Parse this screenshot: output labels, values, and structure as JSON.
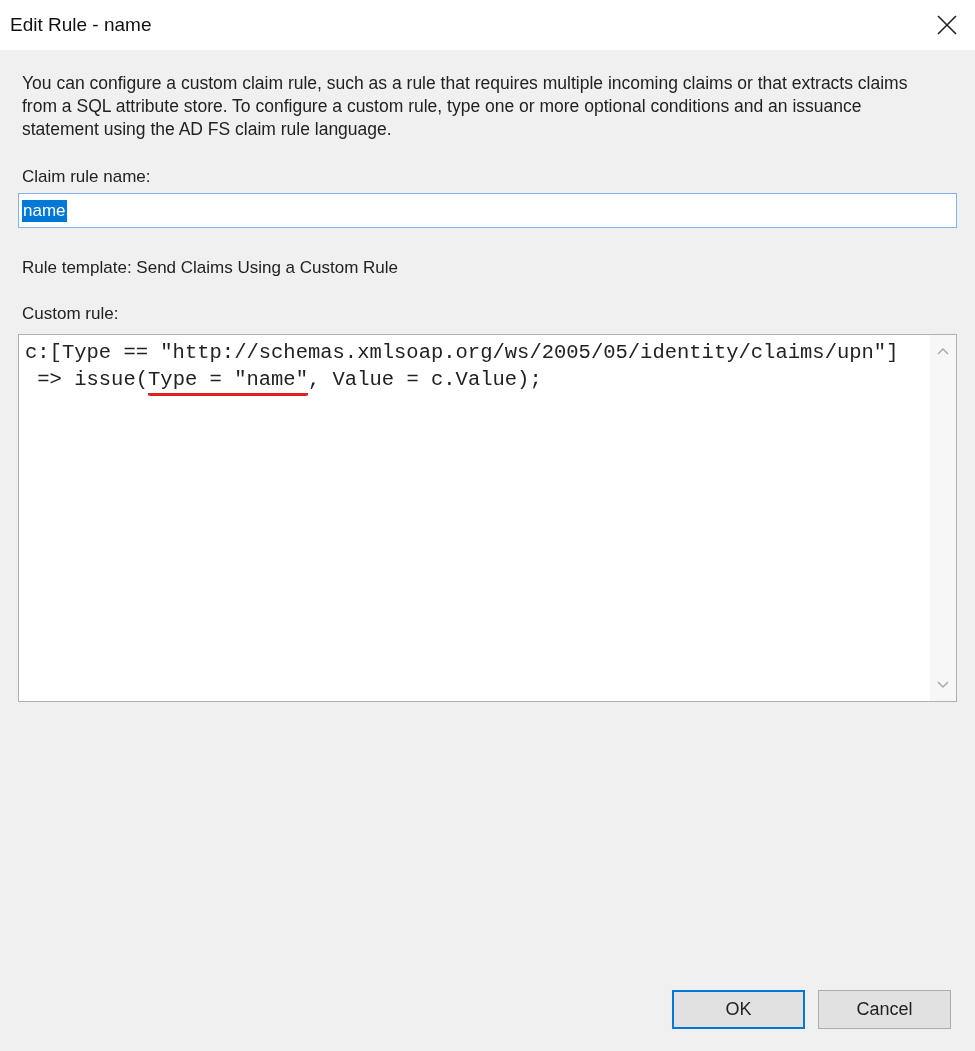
{
  "window": {
    "title": "Edit Rule - name"
  },
  "description": "You can configure a custom claim rule, such as a rule that requires multiple incoming claims or that extracts claims from a SQL attribute store. To configure a custom rule, type one or more optional conditions and an issuance statement using the AD FS claim rule language.",
  "name_field": {
    "label": "Claim rule name:",
    "value": "name",
    "text_selected": true
  },
  "template": "Rule template: Send Claims Using a Custom Rule",
  "custom_rule": {
    "label": "Custom rule:",
    "lines": [
      [
        {
          "text": "c:[Type == \"http://schemas.xmlsoap.org/ws/2005/05/identity/claims/upn\"]",
          "underlined": false
        }
      ],
      [
        {
          "text": " => issue(",
          "underlined": false
        },
        {
          "text": "Type = \"name\"",
          "underlined": true
        },
        {
          "text": ", Value = c.Value);",
          "underlined": false
        }
      ]
    ]
  },
  "buttons": [
    {
      "label": "OK",
      "default": true
    },
    {
      "label": "Cancel",
      "default": false
    }
  ]
}
